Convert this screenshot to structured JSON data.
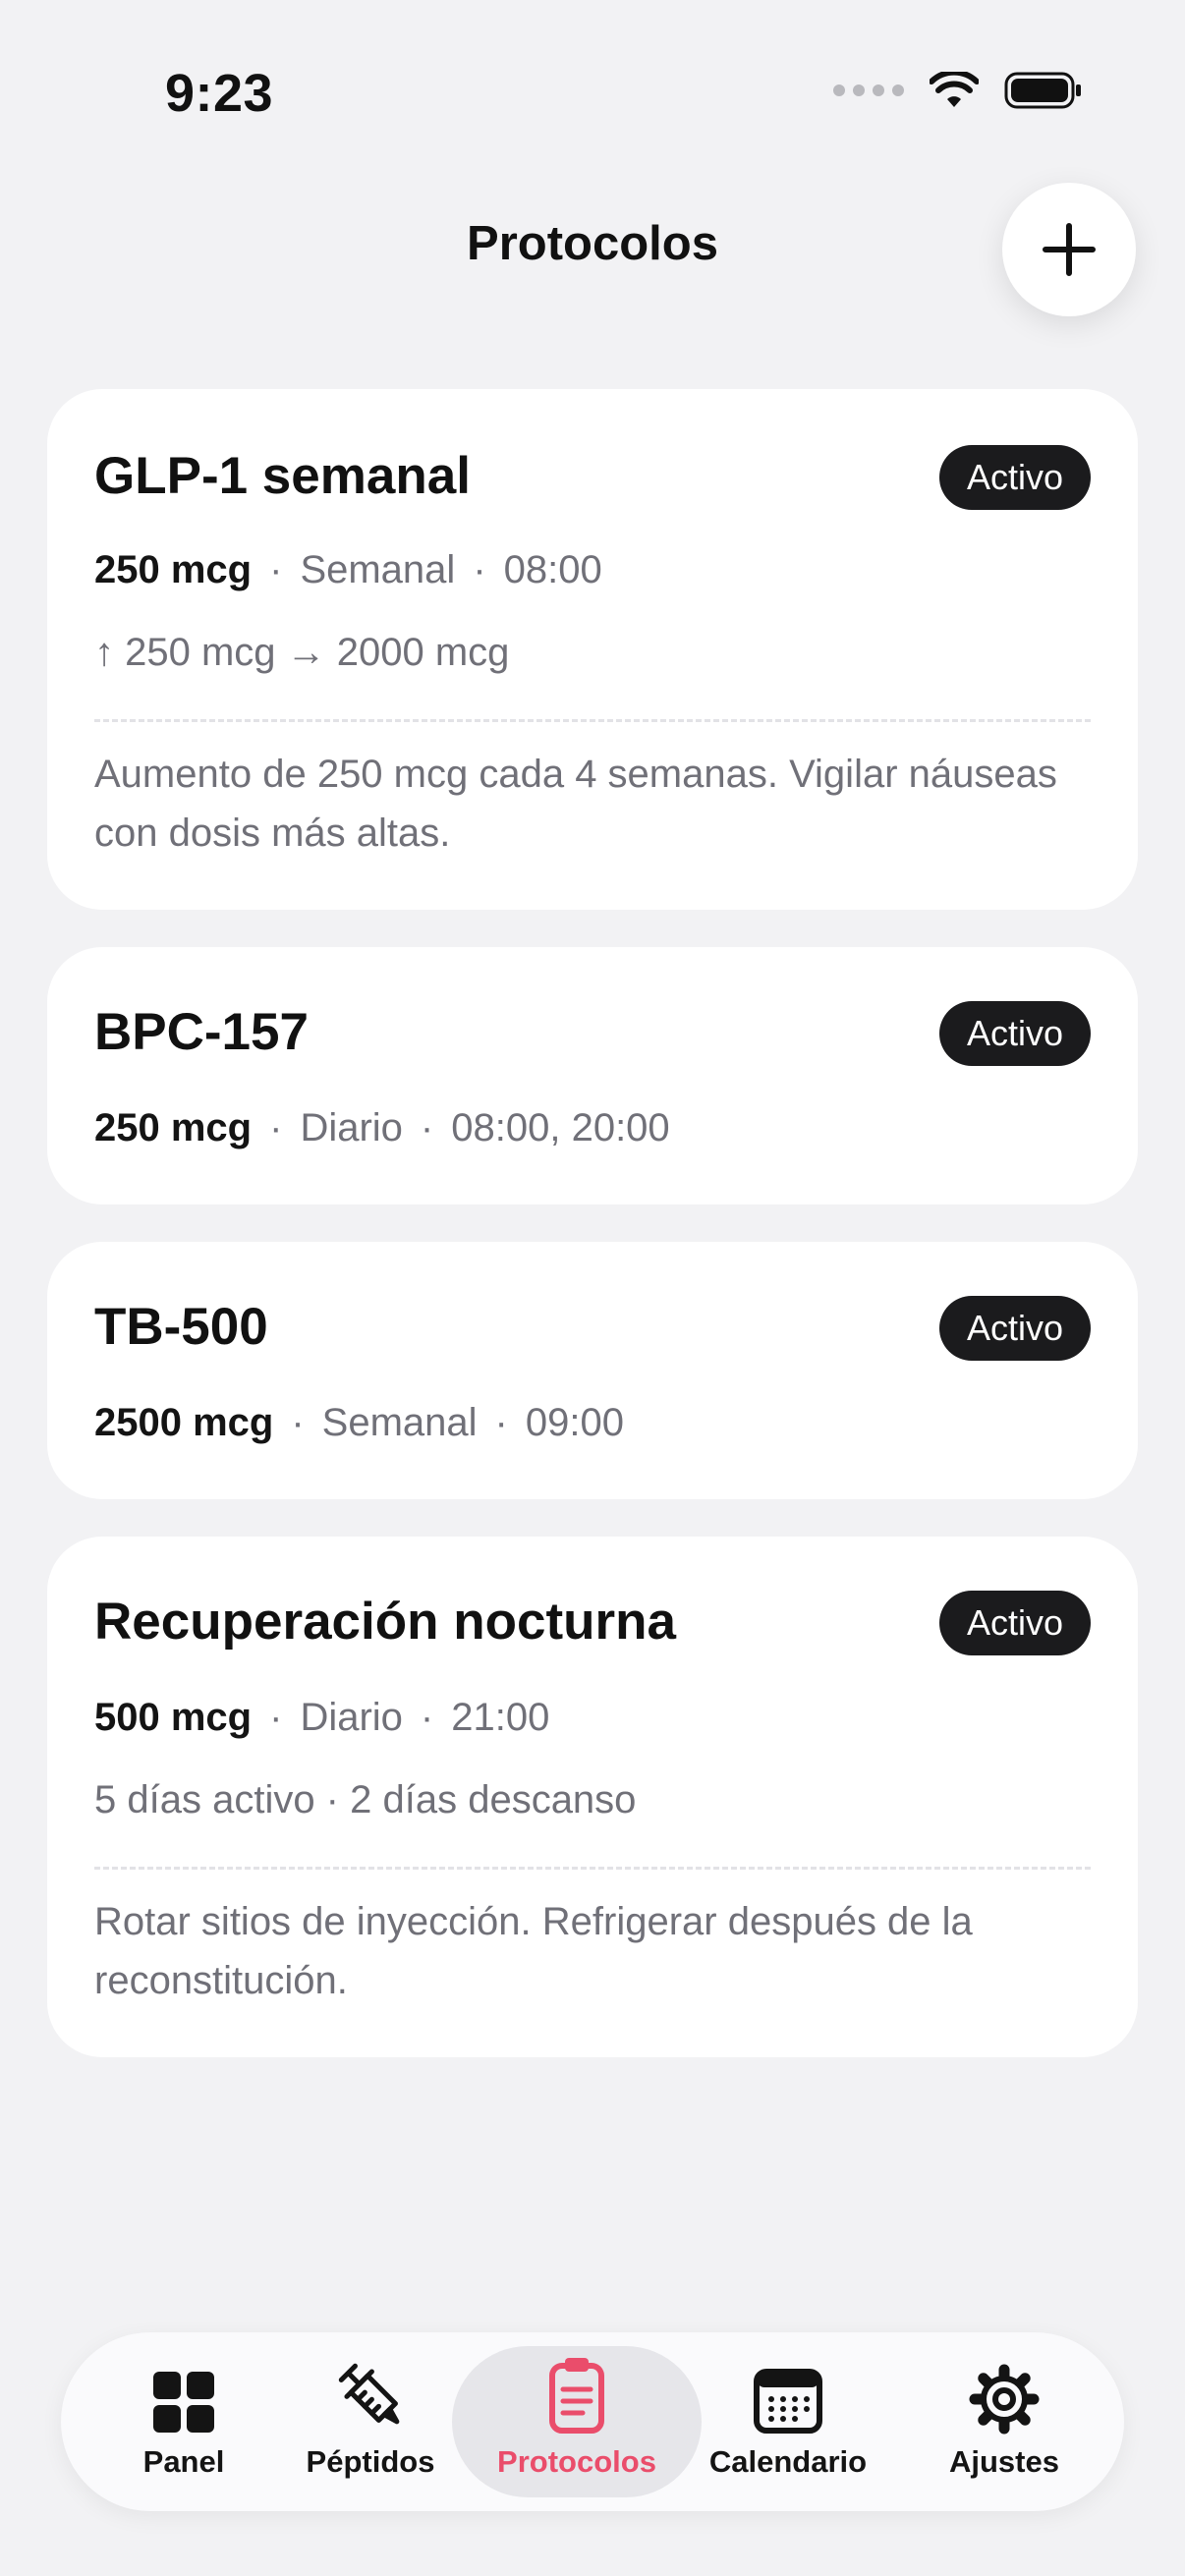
{
  "status": {
    "time": "9:23"
  },
  "header": {
    "title": "Protocolos"
  },
  "protocols": [
    {
      "name": "GLP-1 semanal",
      "badge": "Activo",
      "dose": "250 mcg",
      "frequency": "Semanal",
      "times": "08:00",
      "titration": "↑ 250 mcg → 2000 mcg",
      "notes": "Aumento de 250 mcg cada 4 semanas. Vigilar náuseas con dosis más altas."
    },
    {
      "name": "BPC-157",
      "badge": "Activo",
      "dose": "250 mcg",
      "frequency": "Diario",
      "times": "08:00, 20:00"
    },
    {
      "name": "TB-500",
      "badge": "Activo",
      "dose": "2500 mcg",
      "frequency": "Semanal",
      "times": "09:00"
    },
    {
      "name": "Recuperación nocturna",
      "badge": "Activo",
      "dose": "500 mcg",
      "frequency": "Diario",
      "times": "21:00",
      "cycle": "5 días activo · 2 días descanso",
      "notes": "Rotar sitios de inyección. Refrigerar después de la reconstitución."
    }
  ],
  "tabs": [
    {
      "label": "Panel",
      "icon": "grid-icon"
    },
    {
      "label": "Péptidos",
      "icon": "syringe-icon"
    },
    {
      "label": "Protocolos",
      "icon": "clipboard-icon",
      "active": true
    },
    {
      "label": "Calendario",
      "icon": "calendar-icon"
    },
    {
      "label": "Ajustes",
      "icon": "gear-icon"
    }
  ],
  "colors": {
    "accent": "#ea4d6b",
    "background": "#f2f2f4",
    "badge": "#1b1b1d"
  }
}
